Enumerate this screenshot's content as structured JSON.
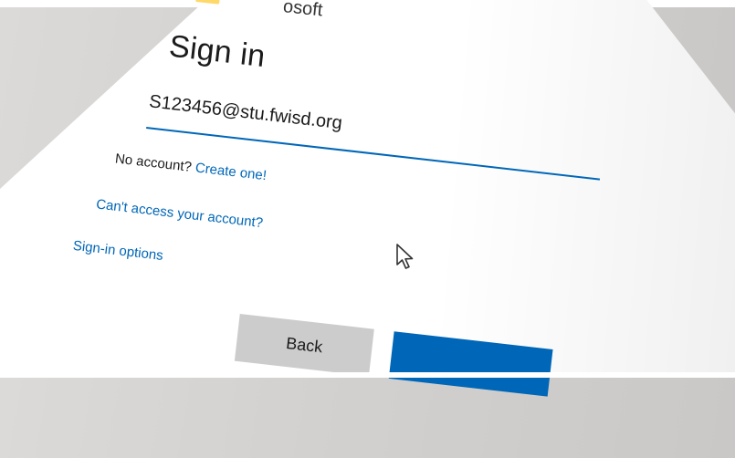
{
  "signin": {
    "brand_fragment": "osoft",
    "title": "Sign in",
    "email_value": "S123456@stu.fwisd.org",
    "no_account_text": "No account?",
    "create_link": "Create one!",
    "cant_access_link": "Can't access your account?",
    "options_link": "Sign-in options",
    "back_label": "Back",
    "next_label": ""
  },
  "colors": {
    "accent": "#0067b8",
    "back_button": "#cccccc"
  },
  "icons": {
    "pointer": "mouse-pointer-icon"
  }
}
